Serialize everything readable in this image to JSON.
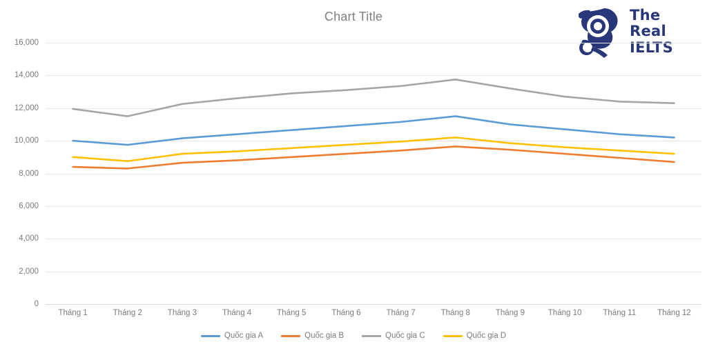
{
  "title": "Chart Title",
  "logo": {
    "line1": "The Real",
    "line2": "IELTS",
    "color": "#27377a",
    "mark": "graduate-owl-mark"
  },
  "axis": {
    "y_ticks": [
      "0",
      "2,000",
      "4,000",
      "6,000",
      "8,000",
      "10,000",
      "12,000",
      "14,000",
      "16,000"
    ],
    "x_ticks": [
      "Tháng 1",
      "Tháng 2",
      "Tháng 3",
      "Tháng 4",
      "Tháng 5",
      "Tháng 6",
      "Tháng 7",
      "Tháng 8",
      "Tháng 9",
      "Tháng 10",
      "Tháng 11",
      "Tháng 12"
    ]
  },
  "legend": [
    {
      "label": "Quốc gia A",
      "color": "#5B9BD5"
    },
    {
      "label": "Quốc gia B",
      "color": "#ED7D31"
    },
    {
      "label": "Quốc gia C",
      "color": "#A5A5A5"
    },
    {
      "label": "Quốc gia D",
      "color": "#FFC000"
    }
  ],
  "chart_data": {
    "type": "line",
    "title": "Chart Title",
    "xlabel": "",
    "ylabel": "",
    "ylim": [
      0,
      16000
    ],
    "ytick_step": 2000,
    "grid": true,
    "legend_position": "bottom",
    "categories": [
      "Tháng 1",
      "Tháng 2",
      "Tháng 3",
      "Tháng 4",
      "Tháng 5",
      "Tháng 6",
      "Tháng 7",
      "Tháng 8",
      "Tháng 9",
      "Tháng 10",
      "Tháng 11",
      "Tháng 12"
    ],
    "series": [
      {
        "name": "Quốc gia A",
        "color": "#5B9BD5",
        "values": [
          10000,
          9750,
          10150,
          10400,
          10650,
          10900,
          11150,
          11500,
          11000,
          10700,
          10400,
          10200
        ]
      },
      {
        "name": "Quốc gia B",
        "color": "#ED7D31",
        "values": [
          8400,
          8300,
          8650,
          8800,
          9000,
          9200,
          9400,
          9650,
          9450,
          9200,
          8950,
          8700
        ]
      },
      {
        "name": "Quốc gia C",
        "color": "#A5A5A5",
        "values": [
          11950,
          11500,
          12250,
          12600,
          12900,
          13100,
          13350,
          13750,
          13200,
          12700,
          12400,
          12300
        ]
      },
      {
        "name": "Quốc gia D",
        "color": "#FFC000",
        "values": [
          9000,
          8750,
          9200,
          9350,
          9550,
          9750,
          9950,
          10200,
          9850,
          9600,
          9400,
          9200
        ]
      }
    ]
  }
}
